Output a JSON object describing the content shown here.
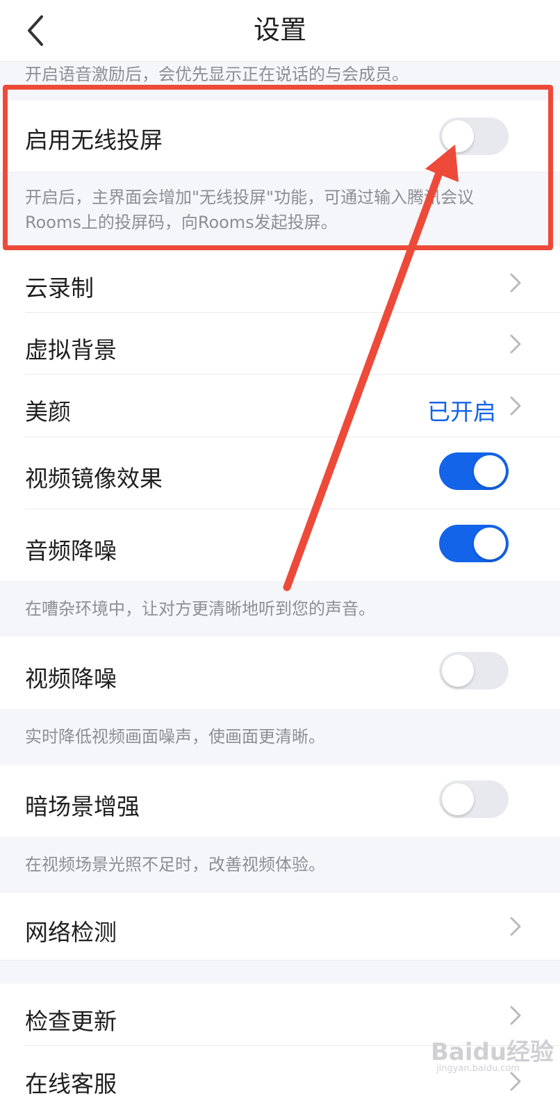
{
  "header": {
    "title": "设置"
  },
  "top_note": "开启语音激励后，会优先显示正在说话的与会成员。",
  "wireless": {
    "label": "启用无线投屏",
    "enabled": false,
    "note_line1": "开启后，主界面会增加\"无线投屏\"功能，可通过输入腾讯会议",
    "note_line2": "Rooms上的投屏码，向Rooms发起投屏。"
  },
  "items": {
    "cloud_record": {
      "label": "云录制"
    },
    "virtual_bg": {
      "label": "虚拟背景"
    },
    "beauty": {
      "label": "美颜",
      "value": "已开启"
    },
    "mirror": {
      "label": "视频镜像效果",
      "enabled": true
    },
    "audio_noise": {
      "label": "音频降噪",
      "enabled": true,
      "note": "在嘈杂环境中，让对方更清晰地听到您的声音。"
    },
    "video_noise": {
      "label": "视频降噪",
      "enabled": false,
      "note": "实时降低视频画面噪声，使画面更清晰。"
    },
    "dark_enhance": {
      "label": "暗场景增强",
      "enabled": false,
      "note": "在视频场景光照不足时，改善视频体验。"
    },
    "network": {
      "label": "网络检测"
    },
    "update": {
      "label": "检查更新"
    },
    "support": {
      "label": "在线客服"
    }
  },
  "watermark": {
    "main": "Baidu经验",
    "sub": "jingyan.baidu.com"
  },
  "colors": {
    "accent": "#1364e8",
    "annotation": "#ed4a3a",
    "section_bg": "#f5f6f9"
  }
}
